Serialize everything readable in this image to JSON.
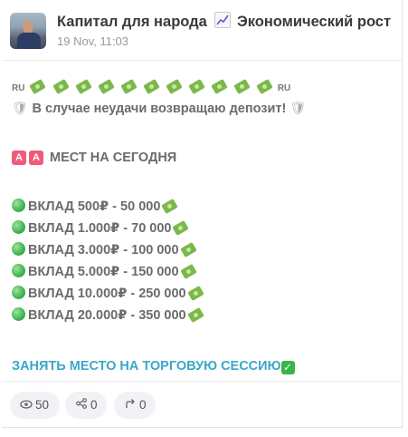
{
  "channel": {
    "title": "Капитал для народа",
    "title_suffix": "Экономический рост",
    "timestamp": "19 Nov, 11:03",
    "avatar_icon": "profile-photo"
  },
  "post": {
    "line1_flag_left": "RU",
    "line1_flag_right": "RU",
    "line2": "В случае неудачи возвращаю депозит!",
    "line3": "МЕСТ НА СЕГОДНЯ",
    "deposits": [
      "ВКЛАД 500₽ - 50 000",
      "ВКЛАД 1.000₽ - 70 000",
      "ВКЛАД 3.000₽ - 100 000",
      "ВКЛАД 5.000₽ - 150 000",
      "ВКЛАД 10.000₽ - 250 000",
      "ВКЛАД 20.000₽ - 350 000"
    ],
    "cta": "ЗАНЯТЬ МЕСТО НА ТОРГОВУЮ СЕССИЮ",
    "a_badge": "A"
  },
  "stats": {
    "views": "50",
    "shares": "0",
    "forwards": "0"
  },
  "colors": {
    "link": "#3aa7c9",
    "badge": "#f05b7a",
    "money": "#7bb84a"
  }
}
